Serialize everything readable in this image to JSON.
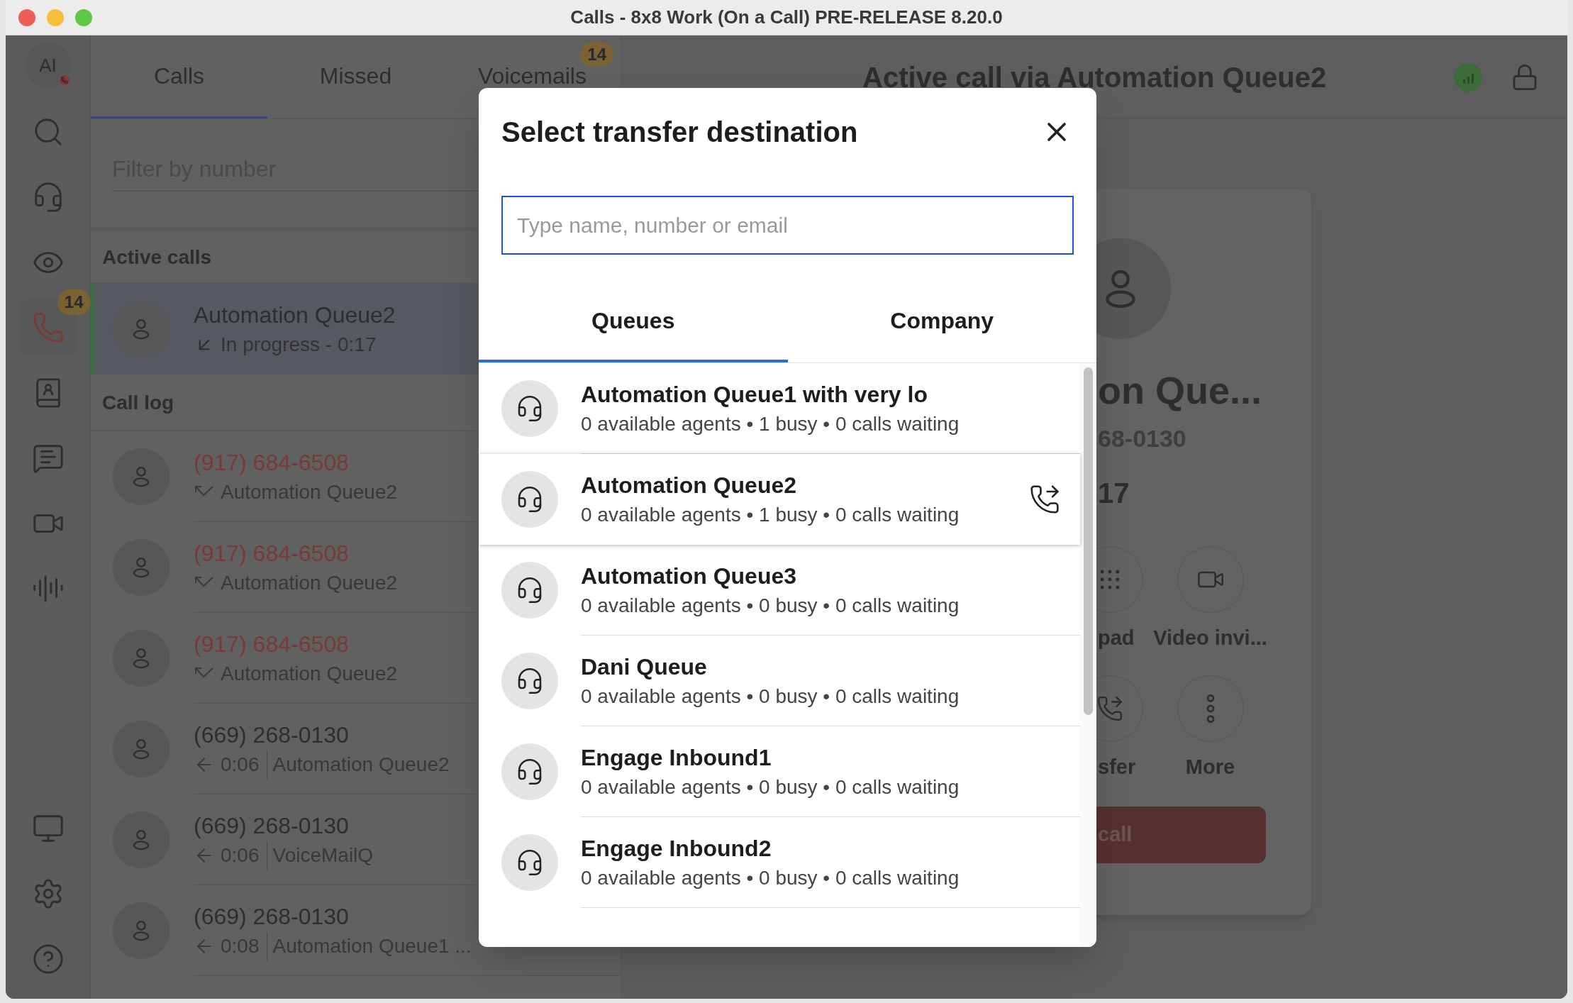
{
  "window": {
    "title": "Calls - 8x8 Work (On a Call) PRE-RELEASE 8.20.0"
  },
  "profile": {
    "initials": "AI",
    "on_call": true
  },
  "nav": {
    "top": [
      {
        "kind": "search",
        "selected": false
      },
      {
        "kind": "headset",
        "selected": false
      },
      {
        "kind": "eye",
        "selected": false
      },
      {
        "kind": "phone",
        "selected": true,
        "badge": "14"
      },
      {
        "kind": "contacts",
        "selected": false
      },
      {
        "kind": "chat",
        "selected": false
      },
      {
        "kind": "video",
        "selected": false
      },
      {
        "kind": "waveform",
        "selected": false
      }
    ],
    "bottom": [
      {
        "kind": "monitor",
        "selected": false
      },
      {
        "kind": "settings",
        "selected": false
      },
      {
        "kind": "help",
        "selected": false
      }
    ]
  },
  "tabs": [
    {
      "label": "Calls",
      "selected": true
    },
    {
      "label": "Missed",
      "selected": false
    },
    {
      "label": "Voicemails",
      "selected": false,
      "badge": "14"
    }
  ],
  "filter": {
    "placeholder": "Filter by number"
  },
  "active_calls": {
    "heading": "Active calls",
    "items": [
      {
        "name": "Automation Queue2",
        "status": "In progress - 0:17",
        "selected": true
      }
    ]
  },
  "call_log": {
    "heading": "Call log",
    "items": [
      {
        "number": "(917) 684-6508",
        "kind": "missed",
        "queue": "Automation Queue2"
      },
      {
        "number": "(917) 684-6508",
        "kind": "missed",
        "queue": "Automation Queue2"
      },
      {
        "number": "(917) 684-6508",
        "kind": "missed",
        "queue": "Automation Queue2"
      },
      {
        "number": "(669) 268-0130",
        "kind": "incoming",
        "duration": "0:06",
        "queue": "Automation Queue2"
      },
      {
        "number": "(669) 268-0130",
        "kind": "incoming",
        "duration": "0:06",
        "queue": "VoiceMailQ"
      },
      {
        "number": "(669) 268-0130",
        "kind": "incoming",
        "duration": "0:08",
        "queue": "Automation Queue1 ..."
      }
    ]
  },
  "call_header": {
    "title": "Active call via Automation Queue2",
    "online": true
  },
  "call_card": {
    "name": "on Que...",
    "number": "68-0130",
    "timer": "17",
    "actions": [
      {
        "kind": "keypad",
        "label": "pad"
      },
      {
        "kind": "video",
        "label": "Video invi..."
      },
      {
        "kind": "transfer",
        "label": "sfer"
      },
      {
        "kind": "more",
        "label": "More"
      }
    ],
    "end_call": "call"
  },
  "dialog": {
    "title": "Select transfer destination",
    "search": {
      "placeholder": "Type name, number or email"
    },
    "tabs": [
      {
        "label": "Queues",
        "selected": true
      },
      {
        "label": "Company",
        "selected": false
      }
    ],
    "queues": [
      {
        "name": "Automation Queue1 with very lo",
        "stats": "0 available agents • 1 busy • 0 calls waiting",
        "selected": false
      },
      {
        "name": "Automation Queue2",
        "stats": "0 available agents • 1 busy • 0 calls waiting",
        "selected": true
      },
      {
        "name": "Automation Queue3",
        "stats": "0 available agents • 0 busy • 0 calls waiting",
        "selected": false
      },
      {
        "name": "Dani Queue",
        "stats": "0 available agents • 0 busy • 0 calls waiting",
        "selected": false
      },
      {
        "name": "Engage Inbound1",
        "stats": "0 available agents • 0 busy • 0 calls waiting",
        "selected": false
      },
      {
        "name": "Engage Inbound2",
        "stats": "0 available agents • 0 busy • 0 calls waiting",
        "selected": false
      }
    ]
  }
}
